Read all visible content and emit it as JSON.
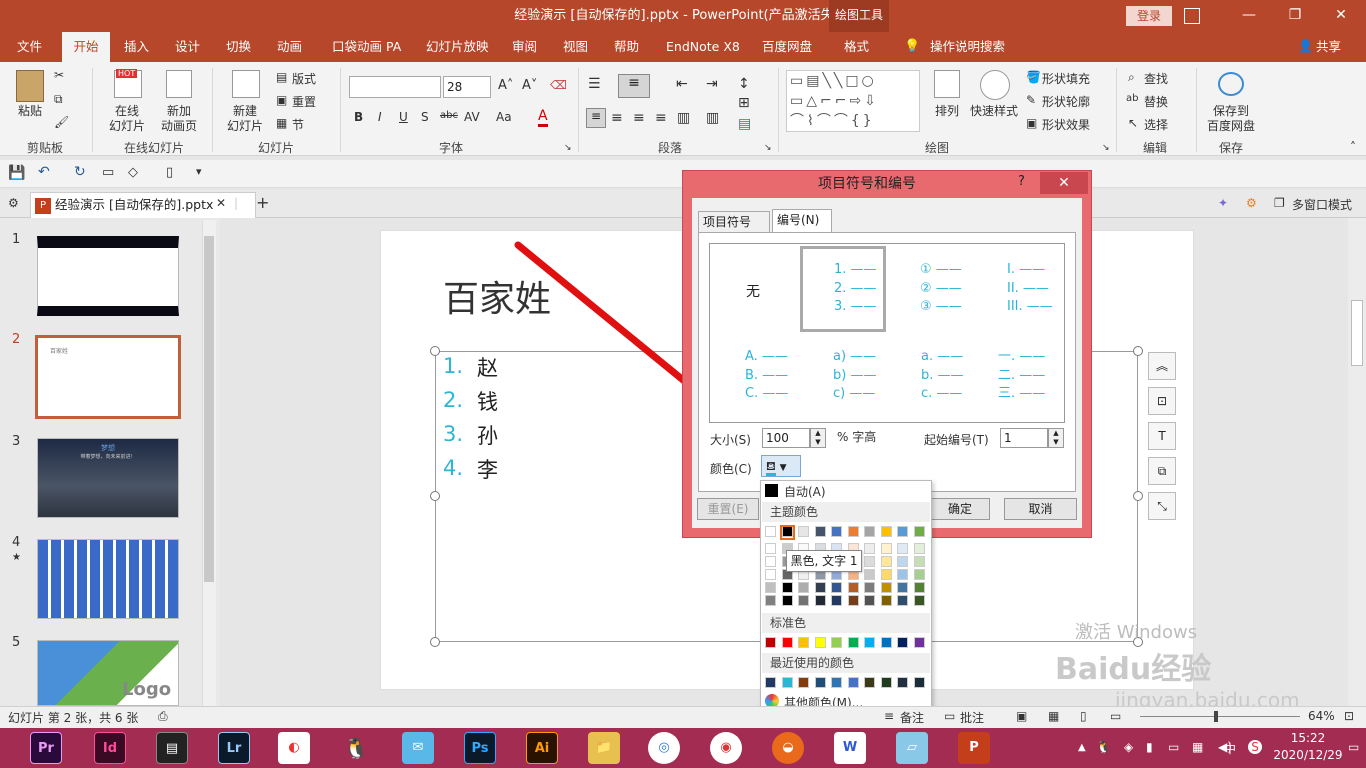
{
  "window": {
    "title": "经验演示 [自动保存的].pptx  -  PowerPoint(产品激活失败)",
    "context_tool": "绘图工具",
    "login": "登录",
    "minimize": "—",
    "restore": "❐",
    "close": "✕"
  },
  "tabs": [
    "文件",
    "开始",
    "插入",
    "设计",
    "切换",
    "动画",
    "口袋动画 PA",
    "幻灯片放映",
    "审阅",
    "视图",
    "帮助",
    "EndNote X8",
    "百度网盘",
    "格式"
  ],
  "tell_me": "操作说明搜索",
  "share": "共享",
  "ribbon": {
    "clipboard": {
      "paste": "粘贴",
      "label": "剪贴板"
    },
    "online": {
      "online_slide": "在线",
      "online_slide2": "幻灯片",
      "new_anim": "新加",
      "new_anim2": "动画页",
      "label": "在线幻灯片",
      "hot": "HOT"
    },
    "slides": {
      "new_slide": "新建",
      "new_slide2": "幻灯片",
      "layout": "版式",
      "reset": "重置",
      "section": "节",
      "label": "幻灯片"
    },
    "font": {
      "name": "",
      "size": "28",
      "label": "字体",
      "bold": "B",
      "italic": "I",
      "underline": "U",
      "shadow": "S",
      "strike": "abc",
      "spacing": "AV",
      "case": "Aa",
      "color": "A"
    },
    "paragraph": {
      "label": "段落"
    },
    "drawing": {
      "arrange": "排列",
      "quick_styles": "快速样式",
      "fill": "形状填充",
      "outline": "形状轮廓",
      "effects": "形状效果",
      "label": "绘图"
    },
    "editing": {
      "find": "查找",
      "replace": "替换",
      "select": "选择",
      "label": "编辑"
    },
    "save": {
      "save_to": "保存到",
      "baidu": "百度网盘",
      "label": "保存"
    }
  },
  "doc_tab": {
    "name": "经验演示 [自动保存的].pptx",
    "close": "✕",
    "add": "+"
  },
  "multi_window": "多窗口模式",
  "thumbnails": [
    {
      "num": "1",
      "star": ""
    },
    {
      "num": "2",
      "star": ""
    },
    {
      "num": "3",
      "star": ""
    },
    {
      "num": "4",
      "star": "★"
    },
    {
      "num": "5",
      "star": ""
    }
  ],
  "thumb_texts": {
    "t2_title": "百家姓",
    "t3_title": "梦想",
    "t3_sub": "带着梦想，向未来前进！",
    "t5_logo": "Logo"
  },
  "slide": {
    "title": "百家姓",
    "items": [
      {
        "num": "1.",
        "text": "赵"
      },
      {
        "num": "2.",
        "text": "钱"
      },
      {
        "num": "3.",
        "text": "孙"
      },
      {
        "num": "4.",
        "text": "李"
      }
    ]
  },
  "dialog": {
    "title": "项目符号和编号",
    "help": "?",
    "close": "✕",
    "tab_bullets": "项目符号(B)",
    "tab_numbering": "编号(N)",
    "none": "无",
    "styles": [
      [
        "1. ——",
        "2. ——",
        "3. ——"
      ],
      [
        "① ——",
        "② ——",
        "③ ——"
      ],
      [
        "I. ——",
        "II. ——",
        "III. ——"
      ],
      [
        "A. ——",
        "B. ——",
        "C. ——"
      ],
      [
        "a) ——",
        "b) ——",
        "c) ——"
      ],
      [
        "a. ——",
        "b. ——",
        "c. ——"
      ],
      [
        "一. ——",
        "二. ——",
        "三. ——"
      ]
    ],
    "size_label": "大小(S)",
    "size_value": "100",
    "size_unit": "% 字高",
    "start_label": "起始编号(T)",
    "start_value": "1",
    "color_label": "颜色(C)",
    "reset": "重置(E)",
    "ok": "确定",
    "cancel": "取消"
  },
  "color_popup": {
    "auto": "自动(A)",
    "theme": "主题颜色",
    "standard": "标准色",
    "recent": "最近使用的颜色",
    "more": "其他颜色(M)...",
    "tooltip": "黑色, 文字 1",
    "theme_top": [
      "#ffffff",
      "#000000",
      "#e7e6e6",
      "#44546a",
      "#4472c4",
      "#ed7d31",
      "#a5a5a5",
      "#ffc000",
      "#5b9bd5",
      "#70ad47"
    ],
    "standard_colors": [
      "#c00000",
      "#ff0000",
      "#ffc000",
      "#ffff00",
      "#92d050",
      "#00b050",
      "#00b0f0",
      "#0070c0",
      "#002060",
      "#7030a0"
    ],
    "recent_colors": [
      "#1f3864",
      "#2bb5d6",
      "#843c0c",
      "#1f4e79",
      "#2e75b6",
      "#4472c4",
      "#3a3a1a",
      "#1e3d1e",
      "#203040",
      "#1a2e3a"
    ]
  },
  "status": {
    "slide_info": "幻灯片 第 2 张，共 6 张",
    "notes": "备注",
    "comments": "批注",
    "zoom": "64%"
  },
  "taskbar": {
    "apps": [
      "Pr",
      "Id",
      "",
      "Lr",
      "",
      "",
      "",
      "Ps",
      "Ai",
      "",
      "",
      "",
      "",
      "",
      "",
      ""
    ],
    "time": "15:22",
    "date": "2020/12/29",
    "ime": "中"
  },
  "watermark": {
    "line1": "激活 Windows",
    "line2": "Baidu经验",
    "line3": "jingyan.baidu.com"
  }
}
